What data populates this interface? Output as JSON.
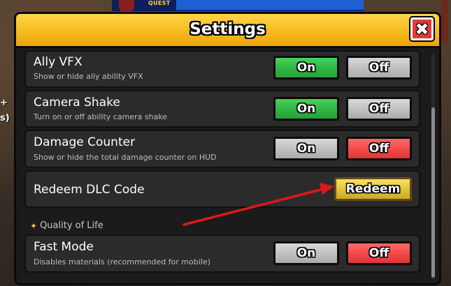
{
  "hud": {
    "quest_label": "QUEST",
    "side_plus": "+",
    "side_fragment": "s)"
  },
  "window": {
    "title": "Settings",
    "close_label": "✖"
  },
  "settings": [
    {
      "title": "Ally VFX",
      "description": "Show or hide ally ability VFX",
      "on_label": "On",
      "off_label": "Off",
      "state": "on"
    },
    {
      "title": "Camera Shake",
      "description": "Turn on or off ability camera shake",
      "on_label": "On",
      "off_label": "Off",
      "state": "on"
    },
    {
      "title": "Damage Counter",
      "description": "Show or hide the total damage counter on HUD",
      "on_label": "On",
      "off_label": "Off",
      "state": "off"
    }
  ],
  "redeem": {
    "title": "Redeem DLC Code",
    "button_label": "Redeem"
  },
  "section": {
    "label": "Quality of Life",
    "icon": "sparkle-icon"
  },
  "fast_mode": {
    "title": "Fast Mode",
    "description": "Disables materials (recommended for mobile)",
    "on_label": "On",
    "off_label": "Off",
    "state": "off"
  },
  "annotation": {
    "type": "red-arrow",
    "color": "#e01818",
    "points_to": "redeem-button"
  },
  "colors": {
    "title_bar": "#f6b81a",
    "active_on": "#2fb543",
    "active_off": "#f24848",
    "inactive": "#bfbfbf",
    "redeem": "#e0c43a"
  }
}
